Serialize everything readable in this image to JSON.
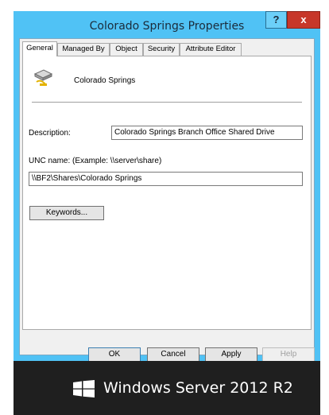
{
  "window": {
    "title": "Colorado Springs Properties",
    "help_label": "?",
    "close_label": "x"
  },
  "tabs": [
    "General",
    "Managed By",
    "Object",
    "Security",
    "Attribute Editor"
  ],
  "active_tab": "General",
  "share": {
    "icon": "shared-folder-icon",
    "name": "Colorado Springs"
  },
  "description": {
    "label": "Description:",
    "value": "Colorado Springs Branch Office Shared Drive"
  },
  "unc": {
    "label": "UNC name: (Example: \\\\server\\share)",
    "value": "\\\\BF2\\Shares\\Colorado Springs"
  },
  "keywords_label": "Keywords...",
  "buttons": {
    "ok": "OK",
    "cancel": "Cancel",
    "apply": "Apply",
    "help": "Help"
  },
  "branding": {
    "icon": "windows-logo-icon",
    "text": "Windows Server 2012 R2"
  },
  "colors": {
    "title_bar": "#50c2f5",
    "close_button": "#c7372a",
    "footer": "#1f1f1f"
  }
}
